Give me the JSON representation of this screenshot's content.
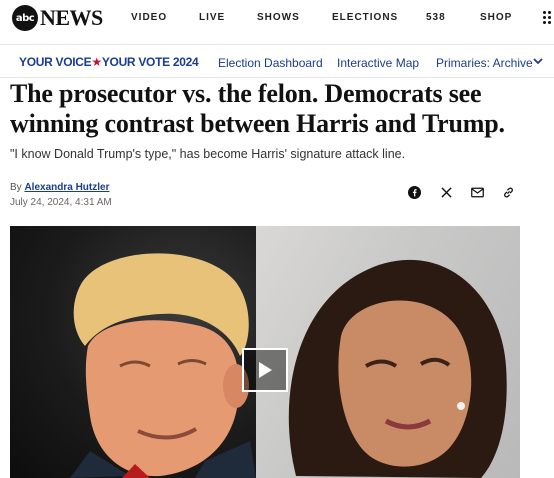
{
  "brand": {
    "logo_abc": "abc",
    "logo_news": "NEWS"
  },
  "nav": {
    "items": [
      "VIDEO",
      "LIVE",
      "SHOWS",
      "ELECTIONS",
      "538",
      "SHOP"
    ]
  },
  "election_bar": {
    "your_voice": "YOUR VOICE",
    "your_vote": "YOUR VOTE 2024",
    "links": [
      "Election Dashboard",
      "Interactive Map",
      "Primaries: Archive"
    ]
  },
  "article": {
    "headline": "The prosecutor vs. the felon. Democrats see winning contrast between Harris and Trump.",
    "subhead": "\"I know Donald Trump's type,\" has become Harris' signature attack line.",
    "byline_prefix": "By",
    "author": "Alexandra Hutzler",
    "date": "July 24, 2024, 4:31 AM"
  },
  "share_icons": [
    "facebook-icon",
    "x-icon",
    "email-icon",
    "link-icon"
  ],
  "colors": {
    "brand_blue": "#1a3d8f",
    "brand_red": "#c8102e"
  }
}
